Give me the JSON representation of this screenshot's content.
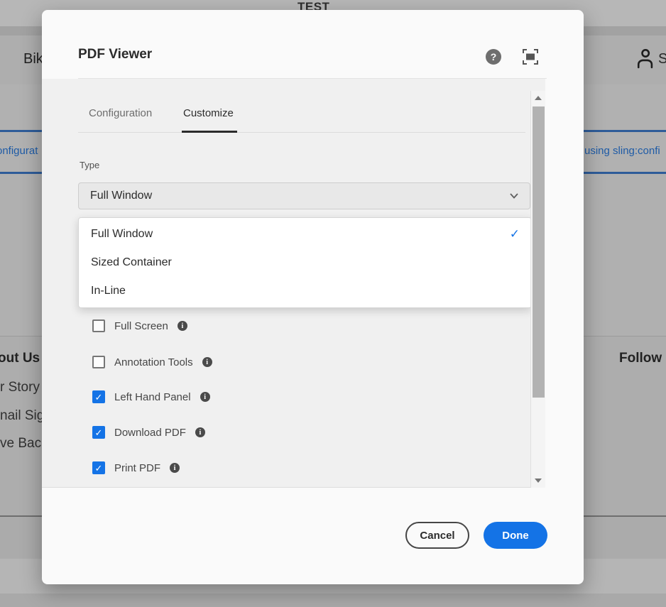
{
  "icons": {
    "check_glyph": "✓",
    "info_glyph": "i",
    "help_glyph": "?"
  },
  "background": {
    "page_title": "TEST",
    "nav_text": "Bik",
    "account_text": "S",
    "left_link": "onfigurat",
    "right_link": "using sling:confi",
    "footer": {
      "about": "out Us",
      "story": "r Story",
      "email": "nail Sig",
      "give": "ve Bac",
      "follow": "Follow"
    }
  },
  "dialog": {
    "title": "PDF Viewer",
    "tabs": [
      {
        "label": "Configuration",
        "active": false
      },
      {
        "label": "Customize",
        "active": true
      }
    ],
    "type_field": {
      "label": "Type",
      "value": "Full Window",
      "options": [
        {
          "label": "Full Window",
          "selected": true
        },
        {
          "label": "Sized Container",
          "selected": false
        },
        {
          "label": "In-Line",
          "selected": false
        }
      ]
    },
    "checkboxes": [
      {
        "label": "Full Screen",
        "checked": false
      },
      {
        "label": "Annotation Tools",
        "checked": false
      },
      {
        "label": "Left Hand Panel",
        "checked": true
      },
      {
        "label": "Download PDF",
        "checked": true
      },
      {
        "label": "Print PDF",
        "checked": true
      }
    ],
    "buttons": {
      "cancel": "Cancel",
      "done": "Done"
    },
    "colors": {
      "accent": "#1473e6",
      "link_blue": "#1e5ba6"
    }
  }
}
